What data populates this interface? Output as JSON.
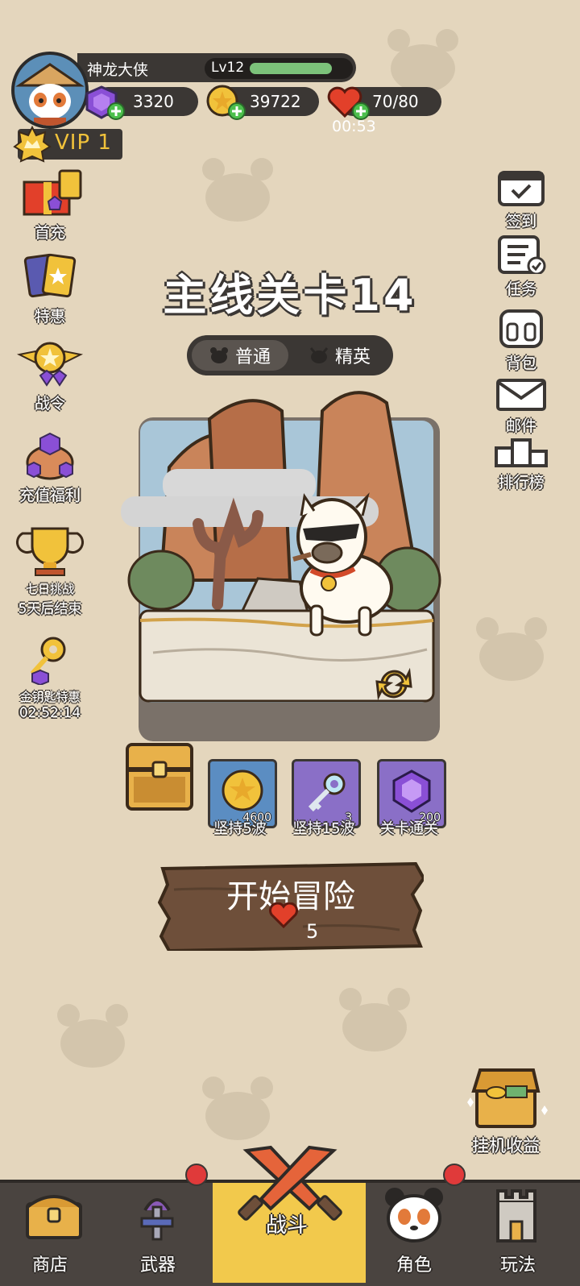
{
  "player": {
    "name": "神龙大侠",
    "level": "Lv12",
    "level_progress": 0.82
  },
  "currencies": {
    "gems": "3320",
    "coins": "39722",
    "stamina": "70/80",
    "stamina_timer": "00:53"
  },
  "vip": {
    "label": "VIP 1"
  },
  "left_menu": [
    {
      "label": "首充"
    },
    {
      "label": "特惠"
    },
    {
      "label": "战令"
    },
    {
      "label": "充值福利"
    },
    {
      "label": "七日挑战",
      "sub": "5天后结束"
    },
    {
      "label": "金钥匙特惠",
      "sub": "02:52:14"
    }
  ],
  "right_menu": [
    {
      "label": "签到"
    },
    {
      "label": "任务"
    },
    {
      "label": "背包"
    },
    {
      "label": "邮件"
    },
    {
      "label": "排行榜"
    }
  ],
  "stage": {
    "title": "主线关卡14",
    "modes": [
      "普通",
      "精英"
    ],
    "selected_mode": "普通"
  },
  "rewards": [
    {
      "label": "坚持5波",
      "count": "4600",
      "icon": "gold-coin"
    },
    {
      "label": "坚持15波",
      "count": "3",
      "icon": "key"
    },
    {
      "label": "关卡通关",
      "count": "200",
      "icon": "purple-gem"
    }
  ],
  "start": {
    "label": "开始冒险",
    "cost": "5"
  },
  "idle": {
    "label": "挂机收益"
  },
  "nav": [
    {
      "label": "商店"
    },
    {
      "label": "武器",
      "badge": true
    },
    {
      "label": "战斗",
      "active": true
    },
    {
      "label": "角色",
      "badge": true
    },
    {
      "label": "玩法"
    }
  ],
  "colors": {
    "background": "#e4d6bd",
    "panel": "#3b3734",
    "gold": "#f1c23b",
    "active_tab": "#f2c94c",
    "badge": "#e03a3a"
  }
}
